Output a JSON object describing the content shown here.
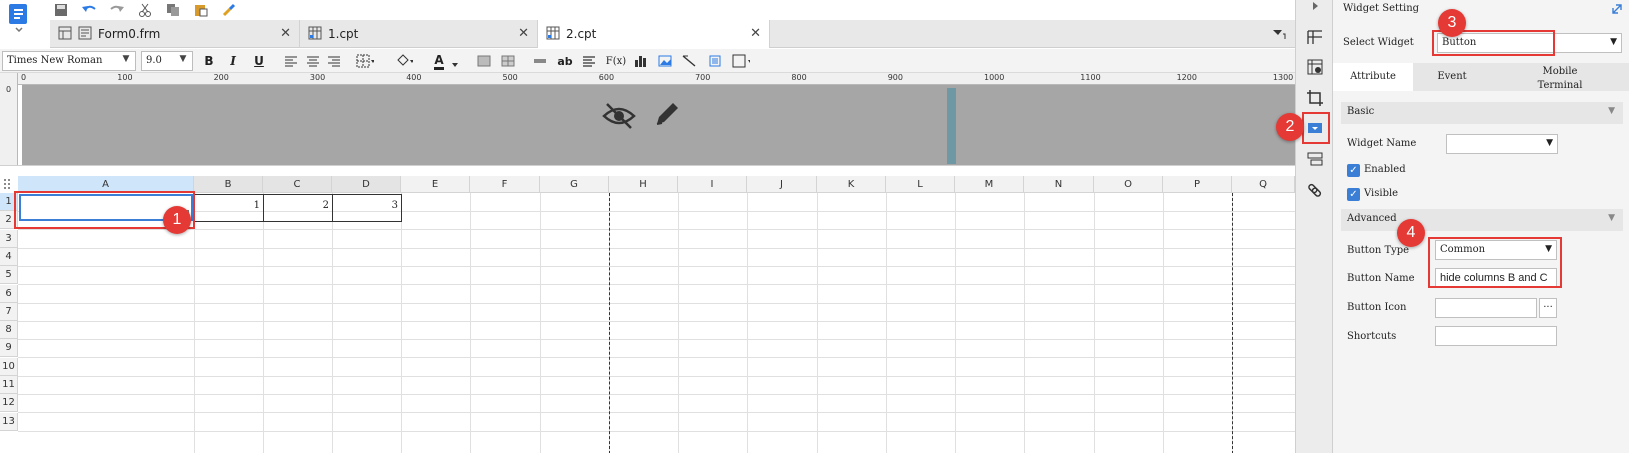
{
  "tabs": [
    {
      "label": "Form0.frm",
      "icon": "form-icon",
      "active": false
    },
    {
      "label": "1.cpt",
      "icon": "report-icon",
      "active": false
    },
    {
      "label": "2.cpt",
      "icon": "report-icon",
      "active": true
    }
  ],
  "format_toolbar": {
    "font_family": "Times New Roman",
    "font_size": "9.0",
    "bold": "B",
    "italic": "I",
    "underline": "U",
    "letter_a": "A",
    "ab": "ab",
    "fx": "F(x)"
  },
  "ruler": {
    "marks": [
      "0",
      "100",
      "200",
      "300",
      "400",
      "500",
      "600",
      "700",
      "800",
      "900",
      "1000",
      "1100",
      "1200",
      "1300"
    ],
    "left_mark": "0"
  },
  "grid": {
    "columns": [
      "A",
      "B",
      "C",
      "D",
      "E",
      "F",
      "G",
      "H",
      "I",
      "J",
      "K",
      "L",
      "M",
      "N",
      "O",
      "P",
      "Q"
    ],
    "rows": [
      "1",
      "2",
      "3",
      "4",
      "5",
      "6",
      "7",
      "8",
      "9",
      "10",
      "11",
      "12",
      "13"
    ],
    "cells": {
      "B1": "1",
      "C1": "2",
      "D1": "3"
    }
  },
  "panel": {
    "title": "Widget Setting",
    "select_widget_label": "Select Widget",
    "select_widget_value": "Button",
    "tabs": [
      "Attribute",
      "Event",
      "Mobile Terminal"
    ],
    "basic_label": "Basic",
    "widget_name_label": "Widget Name",
    "widget_name_value": "",
    "enabled_label": "Enabled",
    "visible_label": "Visible",
    "advanced_label": "Advanced",
    "button_type_label": "Button Type",
    "button_type_value": "Common",
    "button_name_label": "Button Name",
    "button_name_value": "hide columns B and C",
    "button_icon_label": "Button Icon",
    "button_icon_more": "···",
    "shortcuts_label": "Shortcuts"
  },
  "callouts": [
    "1",
    "2",
    "3",
    "4"
  ],
  "colors": {
    "accent": "#e53935",
    "band": "#a6a6a6",
    "checkbox": "#3a7fd5"
  }
}
